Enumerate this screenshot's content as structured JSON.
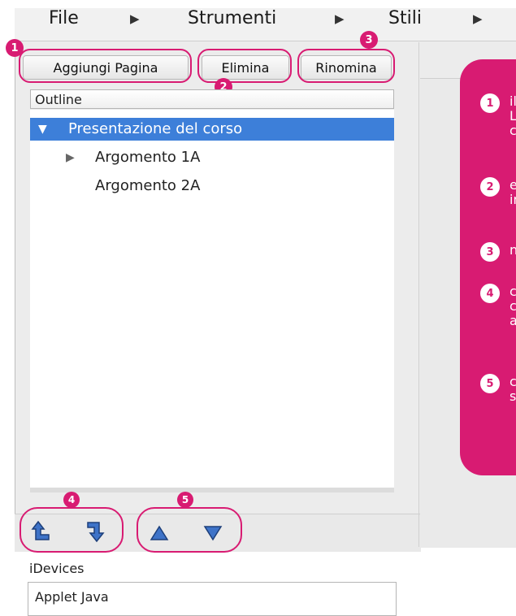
{
  "menu": {
    "items": [
      "File",
      "Strumenti",
      "Stili"
    ]
  },
  "toolbar": {
    "add_page": "Aggiungi Pagina",
    "delete": "Elimina",
    "rename": "Rinomina"
  },
  "badges": [
    "1",
    "2",
    "3",
    "4",
    "5"
  ],
  "outline": {
    "header": "Outline",
    "nodes": [
      {
        "label": "Presentazione del corso",
        "expanded": true,
        "selected": true
      },
      {
        "label": "Argomento 1A",
        "expanded": false,
        "selected": false
      },
      {
        "label": "Argomento 2A",
        "expanded": false,
        "selected": false
      }
    ]
  },
  "idevices": {
    "header": "iDevices",
    "items": [
      "Applet Java"
    ]
  },
  "callout": {
    "items": [
      {
        "n": "1",
        "text": "il\nL\nc"
      },
      {
        "n": "2",
        "text": "e\nin"
      },
      {
        "n": "3",
        "text": "n"
      },
      {
        "n": "4",
        "text": "c\nc\na"
      },
      {
        "n": "5",
        "text": "c\ns"
      }
    ]
  },
  "colors": {
    "accent": "#d81b72",
    "selection": "#3d7fd9",
    "arrow_fill": "#3e73c8"
  },
  "icons": [
    "menu-arrow-icon",
    "disclosure-triangle-icon",
    "promote-node-icon",
    "demote-node-icon",
    "move-up-icon",
    "move-down-icon"
  ]
}
